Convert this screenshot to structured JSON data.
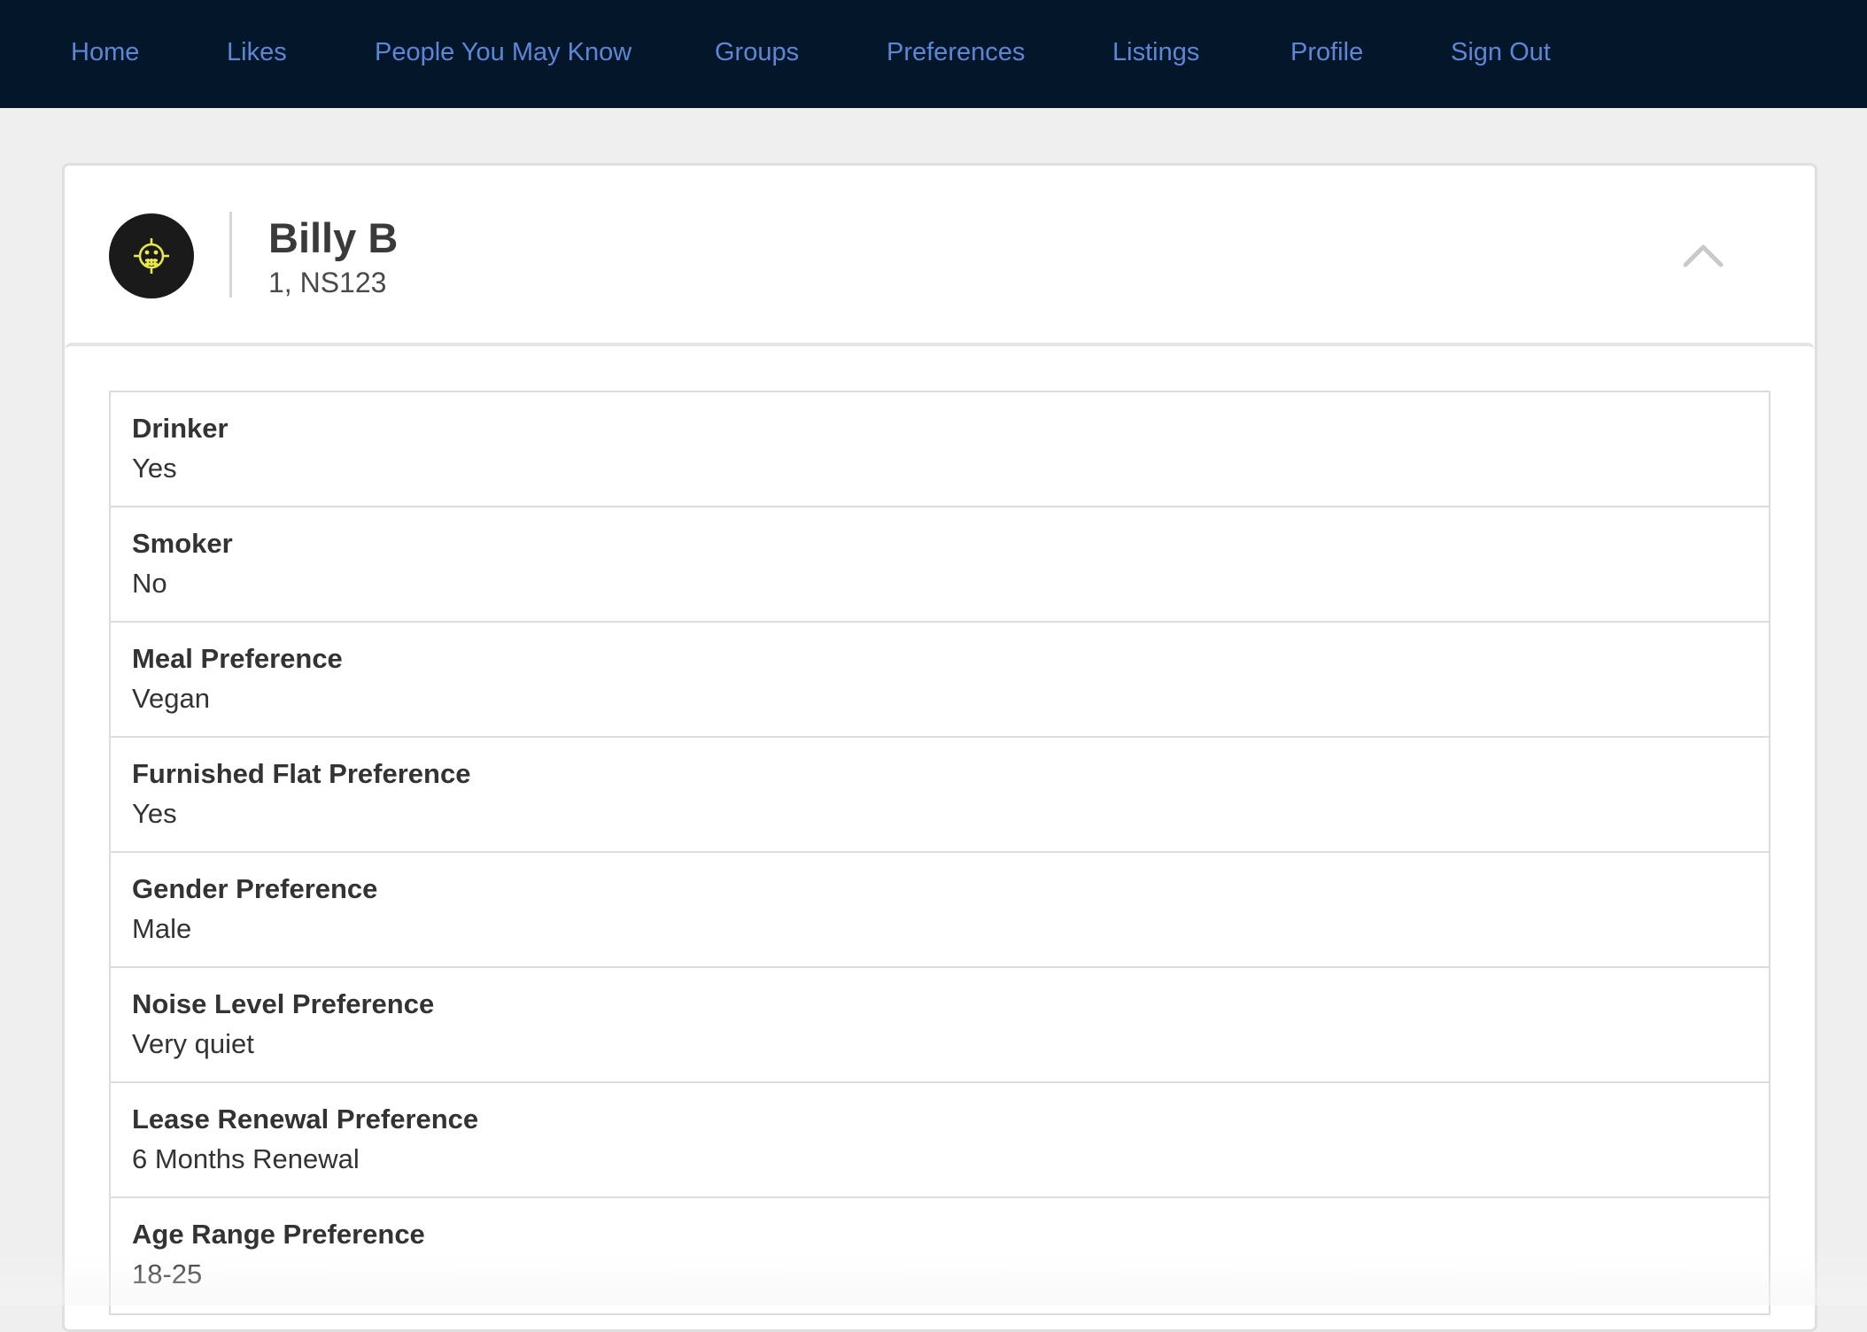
{
  "nav": {
    "items": [
      {
        "label": "Home"
      },
      {
        "label": "Likes"
      },
      {
        "label": "People You May Know"
      },
      {
        "label": "Groups"
      },
      {
        "label": "Preferences"
      },
      {
        "label": "Listings"
      },
      {
        "label": "Profile"
      },
      {
        "label": "Sign Out"
      }
    ]
  },
  "profile": {
    "name": "Billy B",
    "subtitle": "1, NS123",
    "avatar_icon": "smiley-emblem-icon",
    "toggle_icon": "chevron-up-icon"
  },
  "preferences": [
    {
      "label": "Drinker",
      "value": "Yes"
    },
    {
      "label": "Smoker",
      "value": "No"
    },
    {
      "label": "Meal Preference",
      "value": "Vegan"
    },
    {
      "label": "Furnished Flat Preference",
      "value": "Yes"
    },
    {
      "label": "Gender Preference",
      "value": "Male"
    },
    {
      "label": "Noise Level Preference",
      "value": "Very quiet"
    },
    {
      "label": "Lease Renewal Preference",
      "value": "6 Months Renewal"
    },
    {
      "label": "Age Range Preference",
      "value": "18-25"
    }
  ],
  "colors": {
    "navbar": "#03162a",
    "link": "#5e86d6",
    "page_background": "#efefef",
    "avatar_background": "#1a1a1a",
    "avatar_emblem": "#e8e84a"
  }
}
